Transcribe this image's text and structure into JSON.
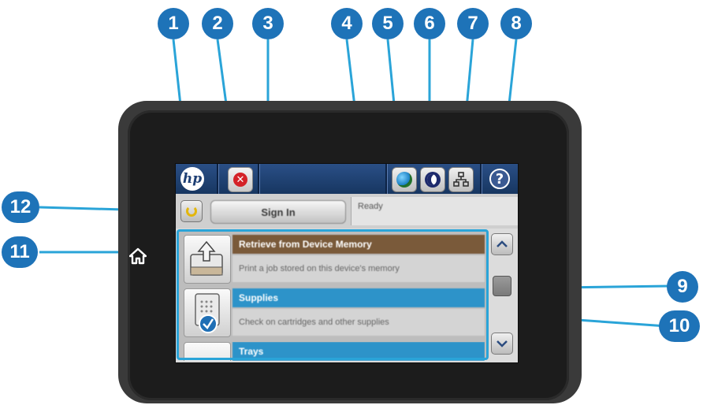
{
  "topbar": {
    "logo_text": "hp",
    "cancel_icon": "x-icon",
    "help_label": "?"
  },
  "statusrow": {
    "signin_label": "Sign In",
    "status_text": "Ready"
  },
  "list_items": [
    {
      "title": "Retrieve from Device Memory",
      "desc": "Print a job stored on this device's memory",
      "title_color": "#7a5a3a"
    },
    {
      "title": "Supplies",
      "desc": "Check on cartridges and other supplies",
      "title_color": "#2d93c9"
    },
    {
      "title": "Trays",
      "desc": "",
      "title_color": "#2d93c9"
    }
  ],
  "callouts": {
    "c1": "1",
    "c2": "2",
    "c3": "3",
    "c4": "4",
    "c5": "5",
    "c6": "6",
    "c7": "7",
    "c8": "8",
    "c9": "9",
    "c10": "10",
    "c11": "11",
    "c12": "12"
  },
  "colors": {
    "callout": "#1e73b8",
    "highlight": "#2aa4d8",
    "topbar": "#1f4275"
  }
}
